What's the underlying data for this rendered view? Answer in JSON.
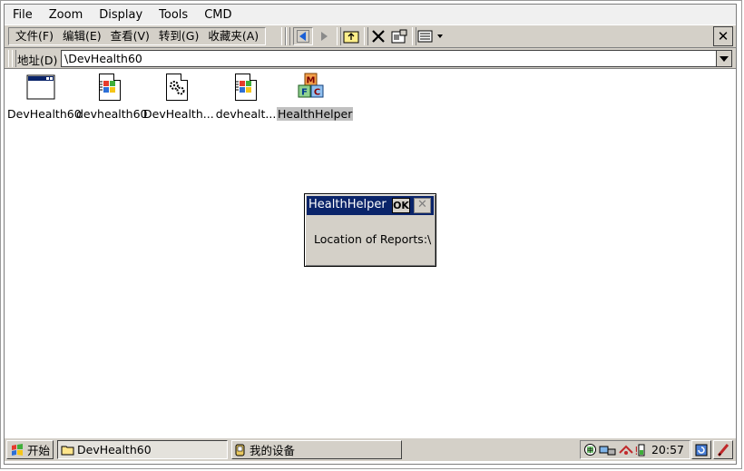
{
  "host_menu": [
    "File",
    "Zoom",
    "Display",
    "Tools",
    "CMD"
  ],
  "device_menu": [
    "文件(F)",
    "编辑(E)",
    "查看(V)",
    "转到(G)",
    "收藏夹(A)"
  ],
  "toolbar": {
    "buttons": [
      "back-icon",
      "forward-icon",
      "up-folder-icon",
      "delete-icon",
      "properties-icon",
      "view-icon"
    ],
    "close_label": "✕"
  },
  "address": {
    "label": "地址(D)",
    "value": "\\DevHealth60"
  },
  "files": [
    {
      "label": "DevHealth60",
      "icon": "app-window-icon"
    },
    {
      "label": "devhealth60",
      "icon": "windows-doc-icon"
    },
    {
      "label": "DevHealth...",
      "icon": "gear-doc-icon"
    },
    {
      "label": "devhealt...",
      "icon": "windows-doc-icon"
    },
    {
      "label": "HealthHelper",
      "icon": "mfc-blocks-icon",
      "selected": true
    }
  ],
  "dialog": {
    "title": "HealthHelper",
    "ok_label": "OK",
    "close_label": "✕",
    "message": "Location of Reports:\\"
  },
  "taskbar": {
    "start_label": "开始",
    "tasks": [
      {
        "label": "DevHealth60",
        "active": true
      },
      {
        "label": "我的设备",
        "active": false
      }
    ],
    "clock": "20:57"
  },
  "colors": {
    "titlebar": "#0a246a",
    "chrome": "#d4d0c8",
    "selection": "#c0c0c0"
  }
}
